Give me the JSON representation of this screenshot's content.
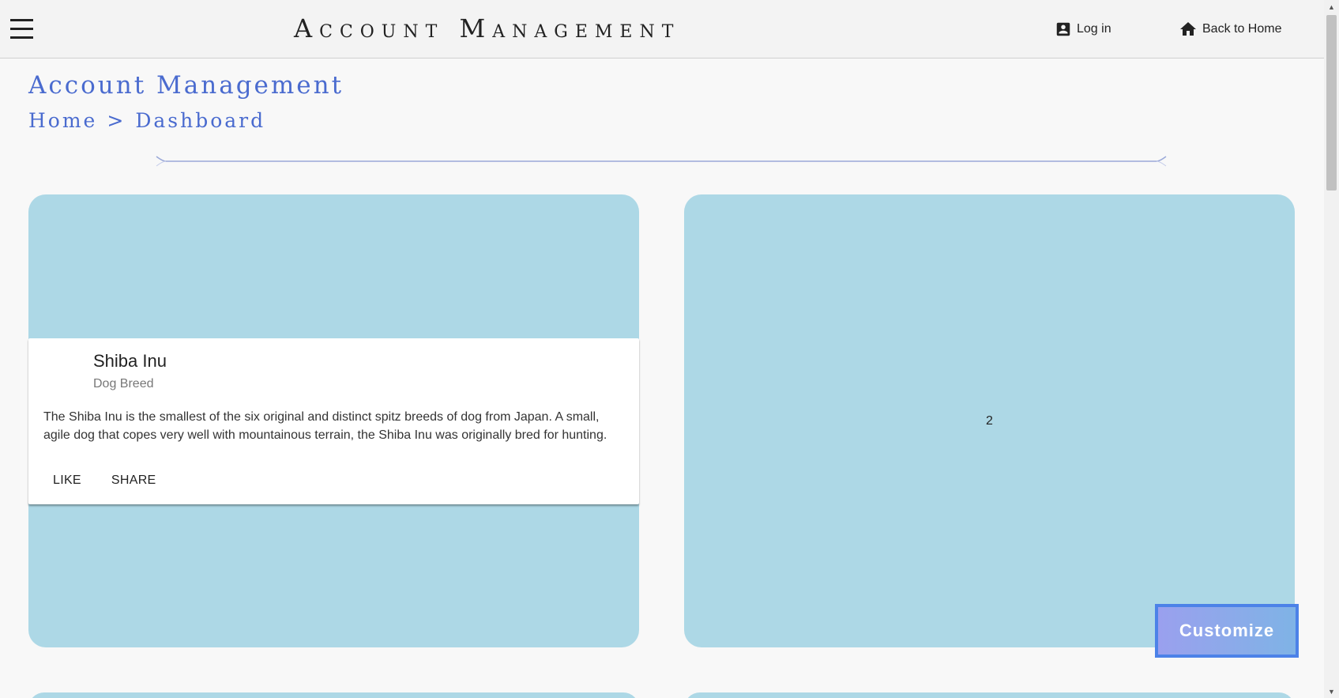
{
  "header": {
    "app_title": "Account Management",
    "login_label": "Log in",
    "home_label": "Back to Home"
  },
  "page": {
    "title": "Account Management",
    "breadcrumb": {
      "home": "Home",
      "separator": ">",
      "current": "Dashboard"
    }
  },
  "card": {
    "title": "Shiba Inu",
    "subtitle": "Dog Breed",
    "body": "The Shiba Inu is the smallest of the six original and distinct spitz breeds of dog from Japan. A small, agile dog that copes very well with mountainous terrain, the Shiba Inu was originally bred for hunting.",
    "actions": [
      "LIKE",
      "SHARE"
    ]
  },
  "tiles": {
    "tile_2_label": "2"
  },
  "customize_label": "Customize",
  "colors": {
    "accent": "#4a6bcf",
    "tile": "#add8e6",
    "button_border": "#4c82e8"
  }
}
